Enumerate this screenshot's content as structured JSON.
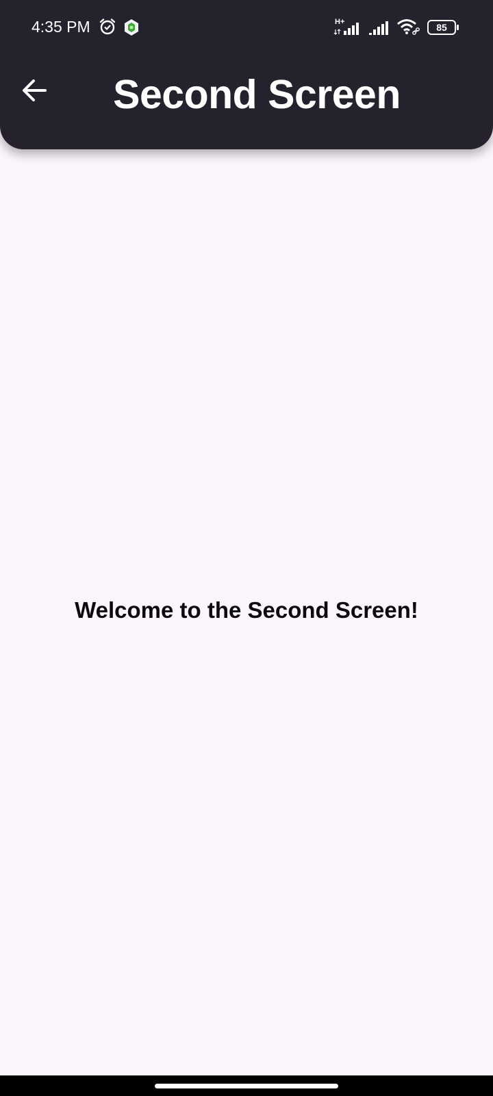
{
  "status_bar": {
    "time": "4:35 PM",
    "network_type": "H+",
    "battery": "85",
    "icons": [
      "alarm-icon",
      "app-status-icon",
      "signal-icon",
      "signal-icon",
      "wifi-icon",
      "battery-icon"
    ]
  },
  "app_bar": {
    "title": "Second Screen",
    "back_icon": "arrow-back-icon",
    "background_color": "#25222e"
  },
  "content": {
    "message": "Welcome to the Second Screen!",
    "background_color": "#fcf6fc"
  }
}
